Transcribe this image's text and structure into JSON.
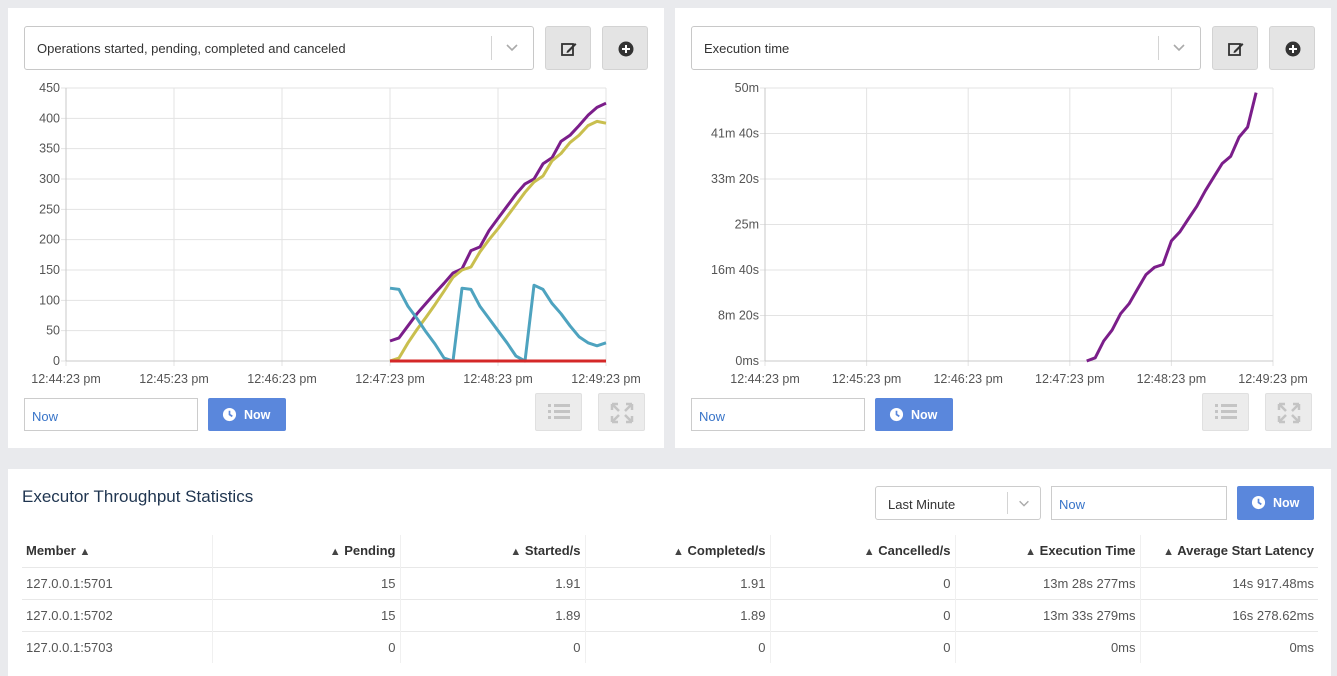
{
  "left_panel": {
    "metric_select": "Operations started, pending, completed and canceled",
    "now_input": "Now",
    "now_button": "Now"
  },
  "right_panel": {
    "metric_select": "Execution time",
    "now_input": "Now",
    "now_button": "Now"
  },
  "stats": {
    "title": "Executor Throughput Statistics",
    "range_select": "Last Minute",
    "now_input": "Now",
    "now_button": "Now",
    "columns": [
      "Member",
      "Pending",
      "Started/s",
      "Completed/s",
      "Cancelled/s",
      "Execution Time",
      "Average Start Latency"
    ],
    "rows": [
      [
        "127.0.0.1:5701",
        "15",
        "1.91",
        "1.91",
        "0",
        "13m 28s 277ms",
        "14s 917.48ms"
      ],
      [
        "127.0.0.1:5702",
        "15",
        "1.89",
        "1.89",
        "0",
        "13m 33s 279ms",
        "16s 278.62ms"
      ],
      [
        "127.0.0.1:5703",
        "0",
        "0",
        "0",
        "0",
        "0ms",
        "0ms"
      ]
    ]
  },
  "icons": [
    "edit-icon",
    "plus-circle-icon",
    "chevron-down-icon",
    "clock-icon",
    "list-icon",
    "expand-icon",
    "sort-icon"
  ],
  "colors": {
    "purple": "#7b1e8a",
    "olive": "#c9bf4e",
    "teal": "#4ea3bf",
    "red": "#d42828",
    "now_button": "#5a87dc"
  },
  "chart_data": [
    {
      "type": "line",
      "title": "",
      "xlabel": "",
      "ylabel": "",
      "x_ticks": [
        "12:44:23 pm",
        "12:45:23 pm",
        "12:46:23 pm",
        "12:47:23 pm",
        "12:48:23 pm",
        "12:49:23 pm"
      ],
      "y_ticks": [
        "0",
        "50",
        "100",
        "150",
        "200",
        "250",
        "300",
        "350",
        "400",
        "450"
      ],
      "ylim": [
        0,
        450
      ],
      "x": [
        "12:47:23 pm",
        "12:47:28 pm",
        "12:47:33 pm",
        "12:47:38 pm",
        "12:47:43 pm",
        "12:47:48 pm",
        "12:47:53 pm",
        "12:47:58 pm",
        "12:48:03 pm",
        "12:48:08 pm",
        "12:48:13 pm",
        "12:48:18 pm",
        "12:48:23 pm",
        "12:48:28 pm",
        "12:48:33 pm",
        "12:48:38 pm",
        "12:48:43 pm",
        "12:48:48 pm",
        "12:48:53 pm",
        "12:48:58 pm",
        "12:49:03 pm",
        "12:49:08 pm",
        "12:49:13 pm",
        "12:49:18 pm",
        "12:49:23 pm"
      ],
      "series": [
        {
          "color": "#7b1e8a",
          "values": [
            33,
            38,
            58,
            78,
            95,
            112,
            128,
            145,
            152,
            182,
            188,
            215,
            235,
            255,
            275,
            292,
            300,
            325,
            335,
            362,
            372,
            388,
            405,
            418,
            425
          ]
        },
        {
          "color": "#c9bf4e",
          "values": [
            0,
            5,
            30,
            52,
            72,
            93,
            115,
            138,
            150,
            155,
            180,
            200,
            218,
            238,
            258,
            278,
            295,
            305,
            330,
            342,
            360,
            372,
            388,
            395,
            392
          ]
        },
        {
          "color": "#4ea3bf",
          "values": [
            120,
            118,
            90,
            70,
            48,
            28,
            5,
            0,
            120,
            118,
            90,
            70,
            50,
            30,
            8,
            0,
            125,
            118,
            95,
            78,
            58,
            40,
            30,
            25,
            30
          ]
        },
        {
          "color": "#d42828",
          "values": [
            0,
            0,
            0,
            0,
            0,
            0,
            0,
            0,
            0,
            0,
            0,
            0,
            0,
            0,
            0,
            0,
            0,
            0,
            0,
            0,
            0,
            0,
            0,
            0,
            0
          ]
        }
      ]
    },
    {
      "type": "line",
      "title": "",
      "xlabel": "",
      "ylabel": "",
      "x_ticks": [
        "12:44:23 pm",
        "12:45:23 pm",
        "12:46:23 pm",
        "12:47:23 pm",
        "12:48:23 pm",
        "12:49:23 pm"
      ],
      "y_ticks": [
        "0ms",
        "8m 20s",
        "16m 40s",
        "25m",
        "33m 20s",
        "41m 40s",
        "50m"
      ],
      "y_unit": "seconds",
      "ylim": [
        0,
        3000
      ],
      "x": [
        "12:47:33 pm",
        "12:47:38 pm",
        "12:47:43 pm",
        "12:47:48 pm",
        "12:47:53 pm",
        "12:47:58 pm",
        "12:48:03 pm",
        "12:48:08 pm",
        "12:48:13 pm",
        "12:48:18 pm",
        "12:48:23 pm",
        "12:48:28 pm",
        "12:48:33 pm",
        "12:48:38 pm",
        "12:48:43 pm",
        "12:48:48 pm",
        "12:48:53 pm",
        "12:48:58 pm",
        "12:49:03 pm",
        "12:49:08 pm",
        "12:49:13 pm"
      ],
      "series": [
        {
          "color": "#7b1e8a",
          "values": [
            0,
            35,
            220,
            340,
            520,
            630,
            790,
            950,
            1030,
            1060,
            1320,
            1420,
            1560,
            1700,
            1870,
            2020,
            2170,
            2250,
            2460,
            2570,
            2950
          ]
        }
      ]
    }
  ]
}
